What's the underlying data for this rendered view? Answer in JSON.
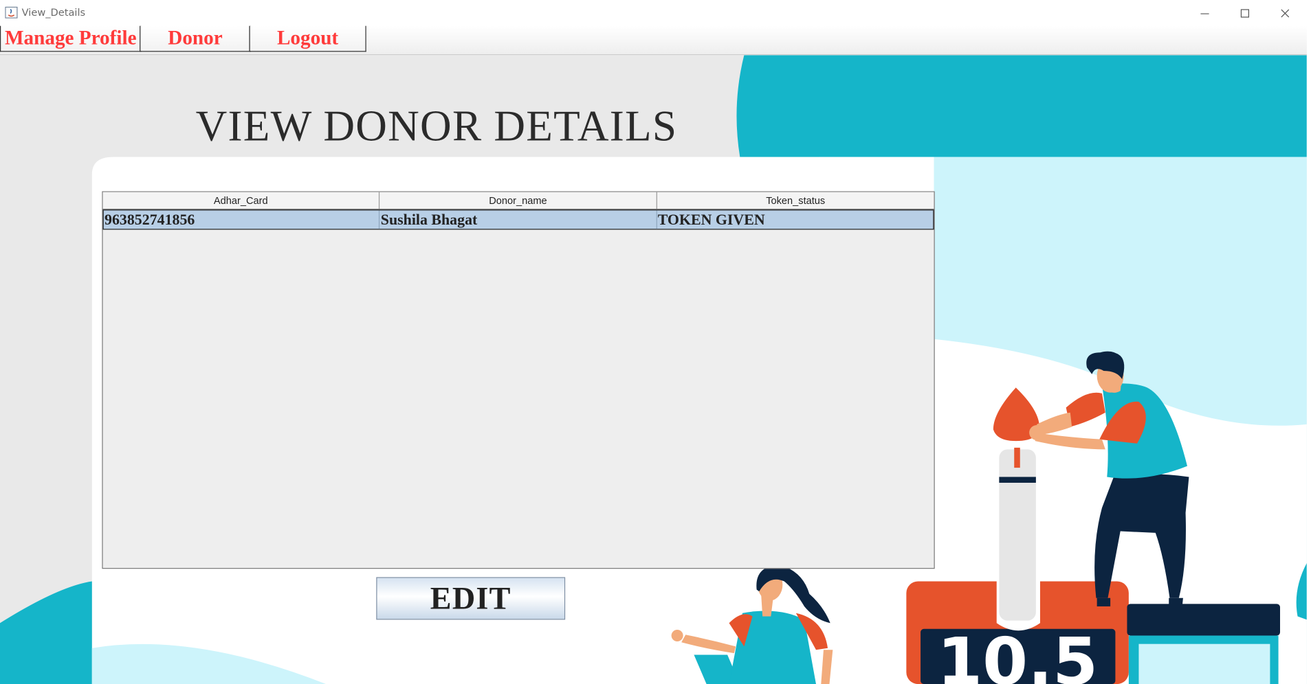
{
  "window": {
    "title": "View_Details"
  },
  "menu": {
    "items": [
      "Manage Profile",
      "Donor",
      "Logout"
    ]
  },
  "page": {
    "heading": "VIEW DONOR DETAILS"
  },
  "table": {
    "columns": [
      "Adhar_Card",
      "Donor_name",
      "Token_status"
    ],
    "rows": [
      [
        "963852741856",
        "Sushila Bhagat",
        "TOKEN GIVEN"
      ]
    ]
  },
  "actions": {
    "edit_label": "EDIT"
  },
  "illustration": {
    "readout": "10.5"
  },
  "colors": {
    "teal": "#15b5c9",
    "light_cyan": "#cdf4fb",
    "menu_red": "#ff3b3b",
    "accent_orange": "#e6532c",
    "navy": "#0c2440",
    "row_selected": "#b8cfe6"
  },
  "icons": [
    "java-app-icon",
    "minimize-icon",
    "maximize-icon",
    "close-icon"
  ]
}
